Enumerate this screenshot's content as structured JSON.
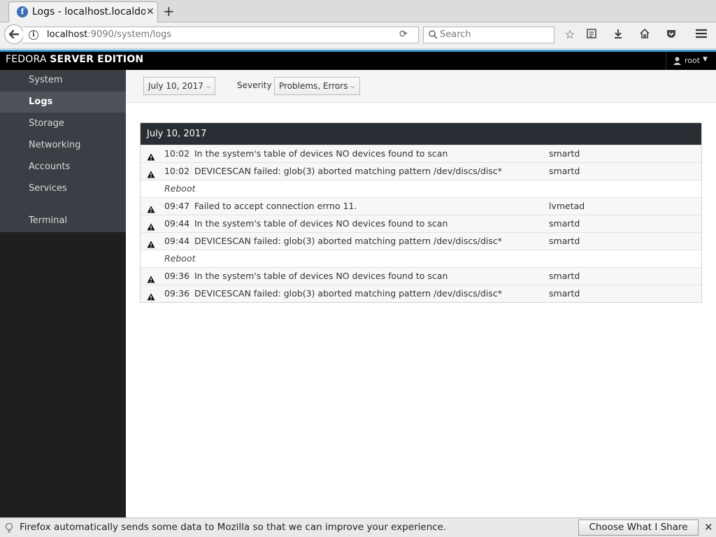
{
  "browser": {
    "tab_title": "Logs - localhost.localdomain",
    "url_host": "localhost",
    "url_rest": ":9090/system/logs",
    "search_placeholder": "Search"
  },
  "cockpit": {
    "brand_prefix": "FEDORA",
    "brand_bold": "SERVER EDITION",
    "user": "root"
  },
  "sidebar": {
    "items": [
      {
        "label": "System"
      },
      {
        "label": "Logs"
      },
      {
        "label": "Storage"
      },
      {
        "label": "Networking"
      },
      {
        "label": "Accounts"
      },
      {
        "label": "Services"
      },
      {
        "label": "Terminal"
      }
    ],
    "active": "Logs"
  },
  "filters": {
    "date": "July 10, 2017",
    "severity_label": "Severity",
    "severity": "Problems, Errors"
  },
  "log": {
    "header": "July 10, 2017",
    "entries": [
      {
        "type": "entry",
        "time": "10:02",
        "message": "In the system's table of devices NO devices found to scan",
        "source": "smartd"
      },
      {
        "type": "entry",
        "time": "10:02",
        "message": "DEVICESCAN failed: glob(3) aborted matching pattern /dev/discs/disc*",
        "source": "smartd"
      },
      {
        "type": "reboot",
        "label": "Reboot"
      },
      {
        "type": "entry",
        "time": "09:47",
        "message": "Failed to accept connection errno 11.",
        "source": "lvmetad"
      },
      {
        "type": "entry",
        "time": "09:44",
        "message": "In the system's table of devices NO devices found to scan",
        "source": "smartd"
      },
      {
        "type": "entry",
        "time": "09:44",
        "message": "DEVICESCAN failed: glob(3) aborted matching pattern /dev/discs/disc*",
        "source": "smartd"
      },
      {
        "type": "reboot",
        "label": "Reboot"
      },
      {
        "type": "entry",
        "time": "09:36",
        "message": "In the system's table of devices NO devices found to scan",
        "source": "smartd"
      },
      {
        "type": "entry",
        "time": "09:36",
        "message": "DEVICESCAN failed: glob(3) aborted matching pattern /dev/discs/disc*",
        "source": "smartd"
      }
    ]
  },
  "notification": {
    "text": "Firefox automatically sends some data to Mozilla so that we can improve your experience.",
    "button": "Choose What I Share"
  },
  "colors": {
    "accent": "#3aa0d9",
    "sidebar": "#393f44",
    "log_header": "#292e34"
  }
}
